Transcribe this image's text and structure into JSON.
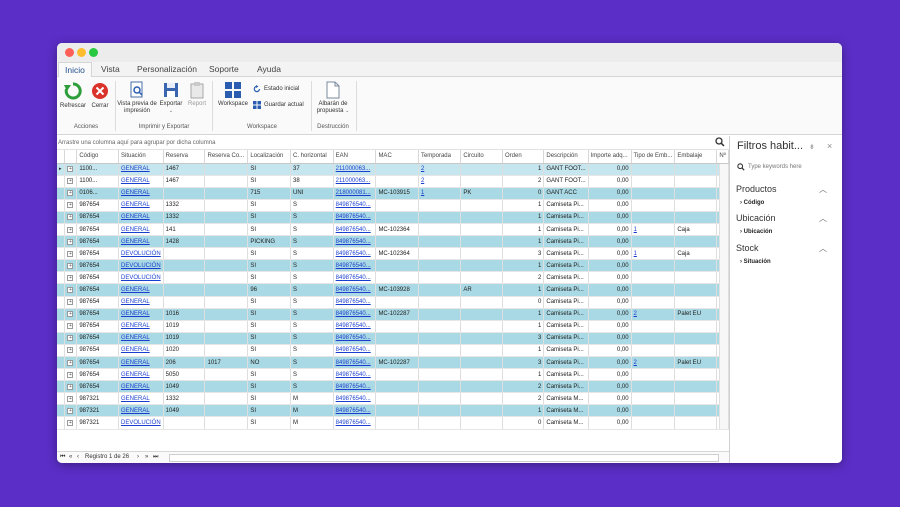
{
  "tabs": [
    "Inicio",
    "Vista",
    "Personalización",
    "Soporte",
    "Ayuda"
  ],
  "ribbon": {
    "refrescar": "Refrescar",
    "cerrar": "Cerrar",
    "group_acciones": "Acciones",
    "vista_previa": "Vista previa de impresión",
    "exportar": "Exportar",
    "report": "Report",
    "group_imprimir": "Imprimir y Exportar",
    "workspace": "Workspace",
    "estado_inicial": "Estado inicial",
    "guardar_actual": "Guardar actual",
    "group_workspace": "Workspace",
    "albaran": "Albarán de propuesta",
    "group_destruccion": "Destrucción"
  },
  "groupbar_text": "Arrastre una columna aquí para agrupar por dicha columna",
  "grid": {
    "columns": [
      "Código",
      "Situación",
      "Reserva",
      "Reserva Co...",
      "Localización",
      "C. horizontal",
      "EAN",
      "MAC",
      "Temporada",
      "Circuito",
      "Orden",
      "Descripción",
      "Importe adq...",
      "Tipo de Emb...",
      "Embalaje",
      "Nº"
    ],
    "rows": [
      [
        "1100...",
        "GENERAL",
        "1467",
        "",
        "SI",
        "37",
        "211000063...",
        "",
        "2",
        "",
        "1",
        "GANT FOOT...",
        "0,00",
        "",
        "",
        ""
      ],
      [
        "1100...",
        "GENERAL",
        "1467",
        "",
        "SI",
        "38",
        "211000063...",
        "",
        "2",
        "",
        "2",
        "GANT FOOT...",
        "0,00",
        "",
        "",
        ""
      ],
      [
        "0106...",
        "GENERAL",
        "",
        "",
        "715",
        "UNI",
        "218000081...",
        "MC-103915",
        "1",
        "PK",
        "0",
        "GANT ACC",
        "0,00",
        "",
        "",
        ""
      ],
      [
        "987654",
        "GENERAL",
        "1332",
        "",
        "SI",
        "S",
        "849876540...",
        "",
        "",
        "",
        "1",
        "Camiseta Pi...",
        "0,00",
        "",
        "",
        ""
      ],
      [
        "987654",
        "GENERAL",
        "1332",
        "",
        "SI",
        "S",
        "849876540...",
        "",
        "",
        "",
        "1",
        "Camiseta Pi...",
        "0,00",
        "",
        "",
        ""
      ],
      [
        "987654",
        "GENERAL",
        "141",
        "",
        "SI",
        "S",
        "849876540...",
        "MC-102364",
        "",
        "",
        "1",
        "Camiseta Pi...",
        "0,00",
        "1",
        "Caja",
        ""
      ],
      [
        "987654",
        "GENERAL",
        "1428",
        "",
        "PICKING",
        "S",
        "849876540...",
        "",
        "",
        "",
        "1",
        "Camiseta Pi...",
        "0,00",
        "",
        "",
        ""
      ],
      [
        "987654",
        "DEVOLUCIÓN",
        "",
        "",
        "SI",
        "S",
        "849876540...",
        "MC-102364",
        "",
        "",
        "3",
        "Camiseta Pi...",
        "0,00",
        "1",
        "Caja",
        ""
      ],
      [
        "987654",
        "DEVOLUCIÓN",
        "",
        "",
        "SI",
        "S",
        "849876540...",
        "",
        "",
        "",
        "1",
        "Camiseta Pi...",
        "0,00",
        "",
        "",
        ""
      ],
      [
        "987654",
        "DEVOLUCIÓN",
        "",
        "",
        "SI",
        "S",
        "849876540...",
        "",
        "",
        "",
        "2",
        "Camiseta Pi...",
        "0,00",
        "",
        "",
        ""
      ],
      [
        "987654",
        "GENERAL",
        "",
        "",
        "96",
        "S",
        "849876540...",
        "MC-103928",
        "",
        "AR",
        "1",
        "Camiseta Pi...",
        "0,00",
        "",
        "",
        ""
      ],
      [
        "987654",
        "GENERAL",
        "",
        "",
        "SI",
        "S",
        "849876540...",
        "",
        "",
        "",
        "0",
        "Camiseta Pi...",
        "0,00",
        "",
        "",
        ""
      ],
      [
        "987654",
        "GENERAL",
        "1016",
        "",
        "SI",
        "S",
        "849876540...",
        "MC-102287",
        "",
        "",
        "1",
        "Camiseta Pi...",
        "0,00",
        "2",
        "Palet EU",
        ""
      ],
      [
        "987654",
        "GENERAL",
        "1019",
        "",
        "SI",
        "S",
        "849876540...",
        "",
        "",
        "",
        "1",
        "Camiseta Pi...",
        "0,00",
        "",
        "",
        ""
      ],
      [
        "987654",
        "GENERAL",
        "1019",
        "",
        "SI",
        "S",
        "849876540...",
        "",
        "",
        "",
        "3",
        "Camiseta Pi...",
        "0,00",
        "",
        "",
        ""
      ],
      [
        "987654",
        "GENERAL",
        "1020",
        "",
        "SI",
        "S",
        "849876540...",
        "",
        "",
        "",
        "1",
        "Camiseta Pi...",
        "0,00",
        "",
        "",
        ""
      ],
      [
        "987654",
        "GENERAL",
        "206",
        "1017",
        "NO",
        "S",
        "849876540...",
        "MC-102287",
        "",
        "",
        "3",
        "Camiseta Pi...",
        "0,00",
        "2",
        "Palet EU",
        ""
      ],
      [
        "987654",
        "GENERAL",
        "5050",
        "",
        "SI",
        "S",
        "849876540...",
        "",
        "",
        "",
        "1",
        "Camiseta Pi...",
        "0,00",
        "",
        "",
        ""
      ],
      [
        "987654",
        "GENERAL",
        "1049",
        "",
        "SI",
        "S",
        "849876540...",
        "",
        "",
        "",
        "2",
        "Camiseta Pi...",
        "0,00",
        "",
        "",
        ""
      ],
      [
        "987321",
        "GENERAL",
        "1332",
        "",
        "SI",
        "M",
        "849876540...",
        "",
        "",
        "",
        "2",
        "Camiseta M...",
        "0,00",
        "",
        "",
        ""
      ],
      [
        "987321",
        "GENERAL",
        "1049",
        "",
        "SI",
        "M",
        "849876540...",
        "",
        "",
        "",
        "1",
        "Camiseta M...",
        "0,00",
        "",
        "",
        ""
      ],
      [
        "987321",
        "DEVOLUCIÓN",
        "",
        "",
        "SI",
        "M",
        "849876540...",
        "",
        "",
        "",
        "0",
        "Camiseta M...",
        "0,00",
        "",
        "",
        ""
      ]
    ]
  },
  "pager": {
    "record_text": "Registro 1 de 26"
  },
  "filters": {
    "title": "Filtros habit...",
    "search_placeholder": "Type keywords here",
    "sections": [
      {
        "title": "Productos",
        "items": [
          "Código"
        ]
      },
      {
        "title": "Ubicación",
        "items": [
          "Ubicación"
        ]
      },
      {
        "title": "Stock",
        "items": [
          "Situación"
        ]
      }
    ]
  },
  "colors": {
    "background": "#5b2ec7",
    "row_band": "#a9d9e4",
    "link": "#1a3fcf",
    "tab_active": "#1f4e8a"
  }
}
